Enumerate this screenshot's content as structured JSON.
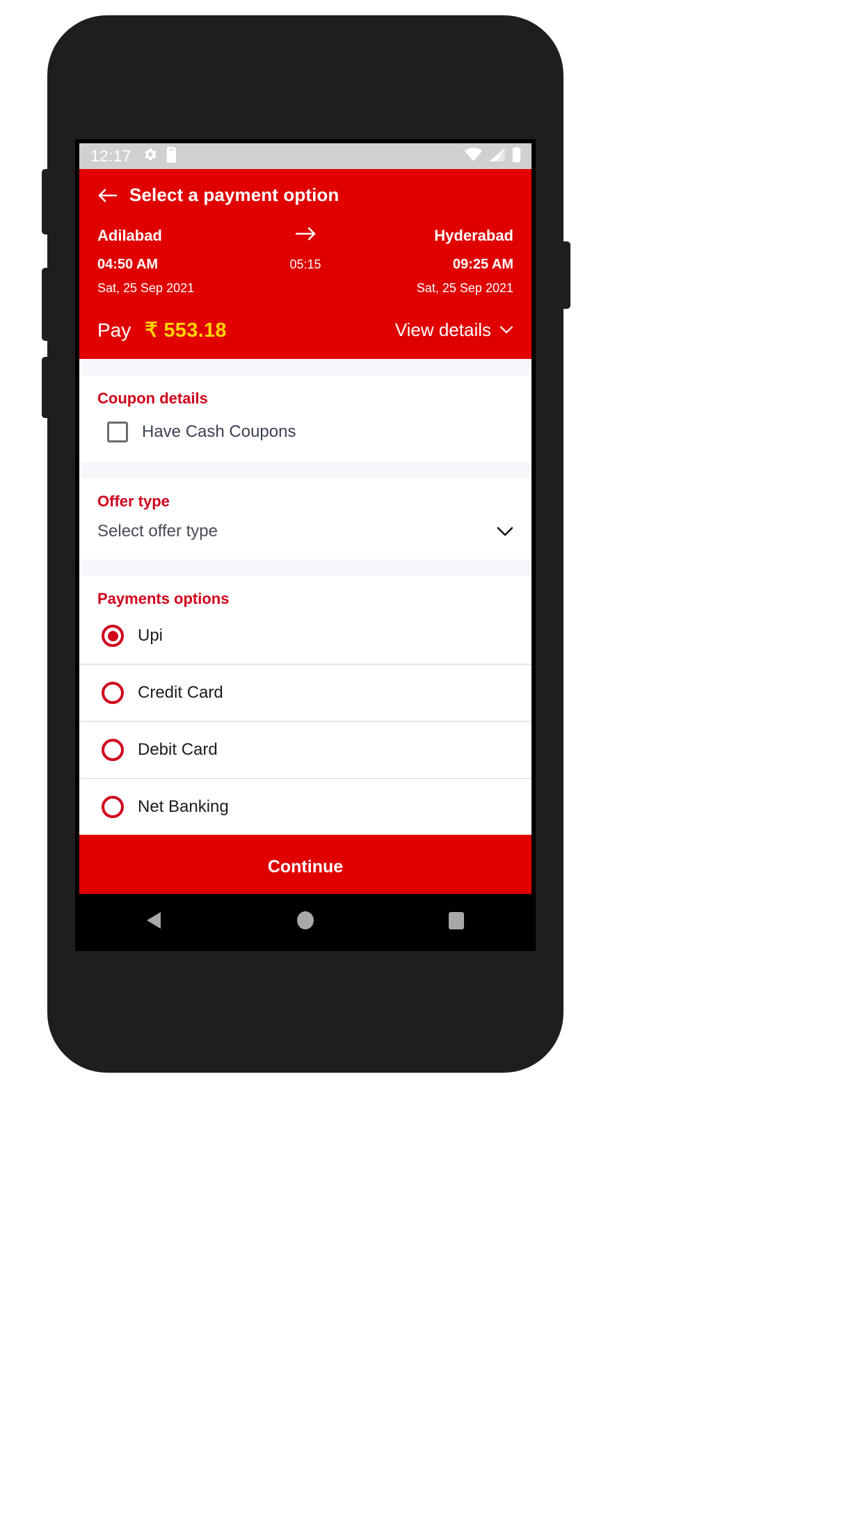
{
  "statusbar": {
    "time": "12:17",
    "left_icons": [
      "gear-icon",
      "sd-card-icon"
    ],
    "right_icons": [
      "wifi-icon",
      "cellular-signal-icon",
      "battery-icon"
    ]
  },
  "appbar": {
    "back_icon": "arrow-left-icon",
    "title": "Select a payment option",
    "bg_color": "#e00000"
  },
  "journey": {
    "origin_city": "Adilabad",
    "destination_city": "Hyderabad",
    "arrow_icon": "arrow-right-icon",
    "departure_time": "04:50 AM",
    "duration": "05:15",
    "arrival_time": "09:25 AM",
    "departure_date": "Sat, 25 Sep 2021",
    "arrival_date": "Sat, 25 Sep 2021"
  },
  "pay": {
    "label": "Pay",
    "amount": "₹ 553.18",
    "amount_color": "#ffd400",
    "view_details_label": "View details",
    "view_details_icon": "chevron-down-icon"
  },
  "coupon": {
    "title": "Coupon details",
    "checkbox_label": "Have Cash Coupons",
    "checked": false
  },
  "offer": {
    "title": "Offer type",
    "selected_value": "Select offer type",
    "dropdown_icon": "chevron-down-icon"
  },
  "payments": {
    "title": "Payments options",
    "options": [
      {
        "label": "Upi",
        "selected": true
      },
      {
        "label": "Credit Card",
        "selected": false
      },
      {
        "label": "Debit Card",
        "selected": false
      },
      {
        "label": "Net Banking",
        "selected": false
      }
    ]
  },
  "footer": {
    "continue_label": "Continue"
  },
  "navbar": {
    "back_icon": "nav-back-triangle-icon",
    "home_icon": "nav-home-circle-icon",
    "recents_icon": "nav-recents-square-icon"
  },
  "theme": {
    "brand_red": "#e00000",
    "section_red": "#d0021b",
    "accent_yellow": "#ffd400",
    "page_bg": "#f5f7fa"
  }
}
